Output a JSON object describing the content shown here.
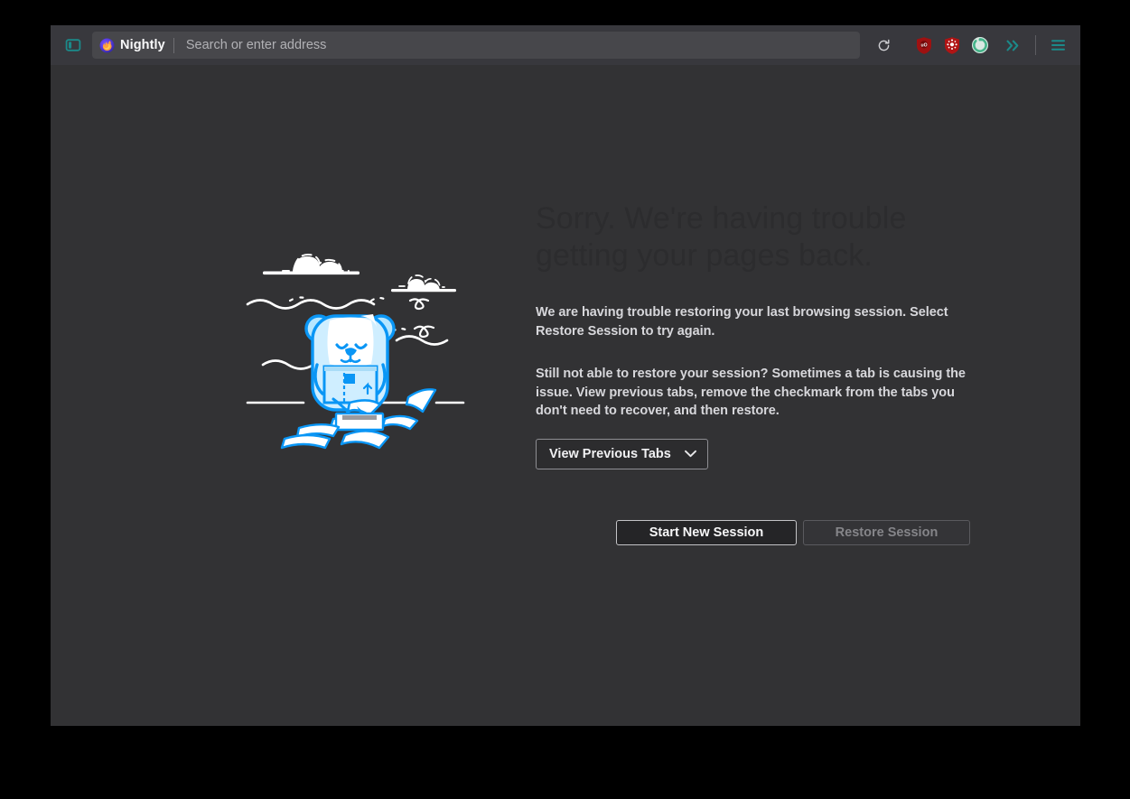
{
  "window": {
    "chrome_bg": "#38383d",
    "content_bg": "#323234"
  },
  "toolbar": {
    "sidebar_button_title": "Sidebars",
    "brand_label": "Nightly",
    "urlbar_value": "",
    "urlbar_placeholder": "Search or enter address",
    "reload_title": "Reload",
    "extensions": [
      {
        "name": "ublock-origin-extension",
        "label": "uO",
        "title": "uBlock Origin",
        "color": "#9e1111"
      },
      {
        "name": "privacy-shield-extension",
        "label": "",
        "title": "Privacy Extension",
        "color": "#b01414"
      },
      {
        "name": "green-circle-extension",
        "label": "",
        "title": "Extension",
        "color": "#57b894"
      }
    ],
    "overflow_title": "More tools",
    "menu_title": "Open application menu",
    "accent_teal": "#1b8a8a"
  },
  "errorpage": {
    "title": "Sorry. We're having trouble getting your pages back.",
    "paragraph1": "We are having trouble restoring your last browsing session. Select Restore Session to try again.",
    "paragraph2": "Still not able to restore your session? Sometimes a tab is causing the issue. View previous tabs, remove the checkmark from the tabs you don't need to recover, and then restore.",
    "tabs_dropdown_label": "View Previous Tabs",
    "primary_button_label": "Start New Session",
    "secondary_button_label": "Restore Session",
    "secondary_button_disabled": true,
    "illustration_name": "polar-bear-with-box-illustration",
    "illustration_colors": {
      "blue": "#0a96f5",
      "pale_blue": "#cfeeff",
      "white": "#ffffff"
    },
    "title_color": "#2c2c2e",
    "body_color": "#d7d7db"
  }
}
